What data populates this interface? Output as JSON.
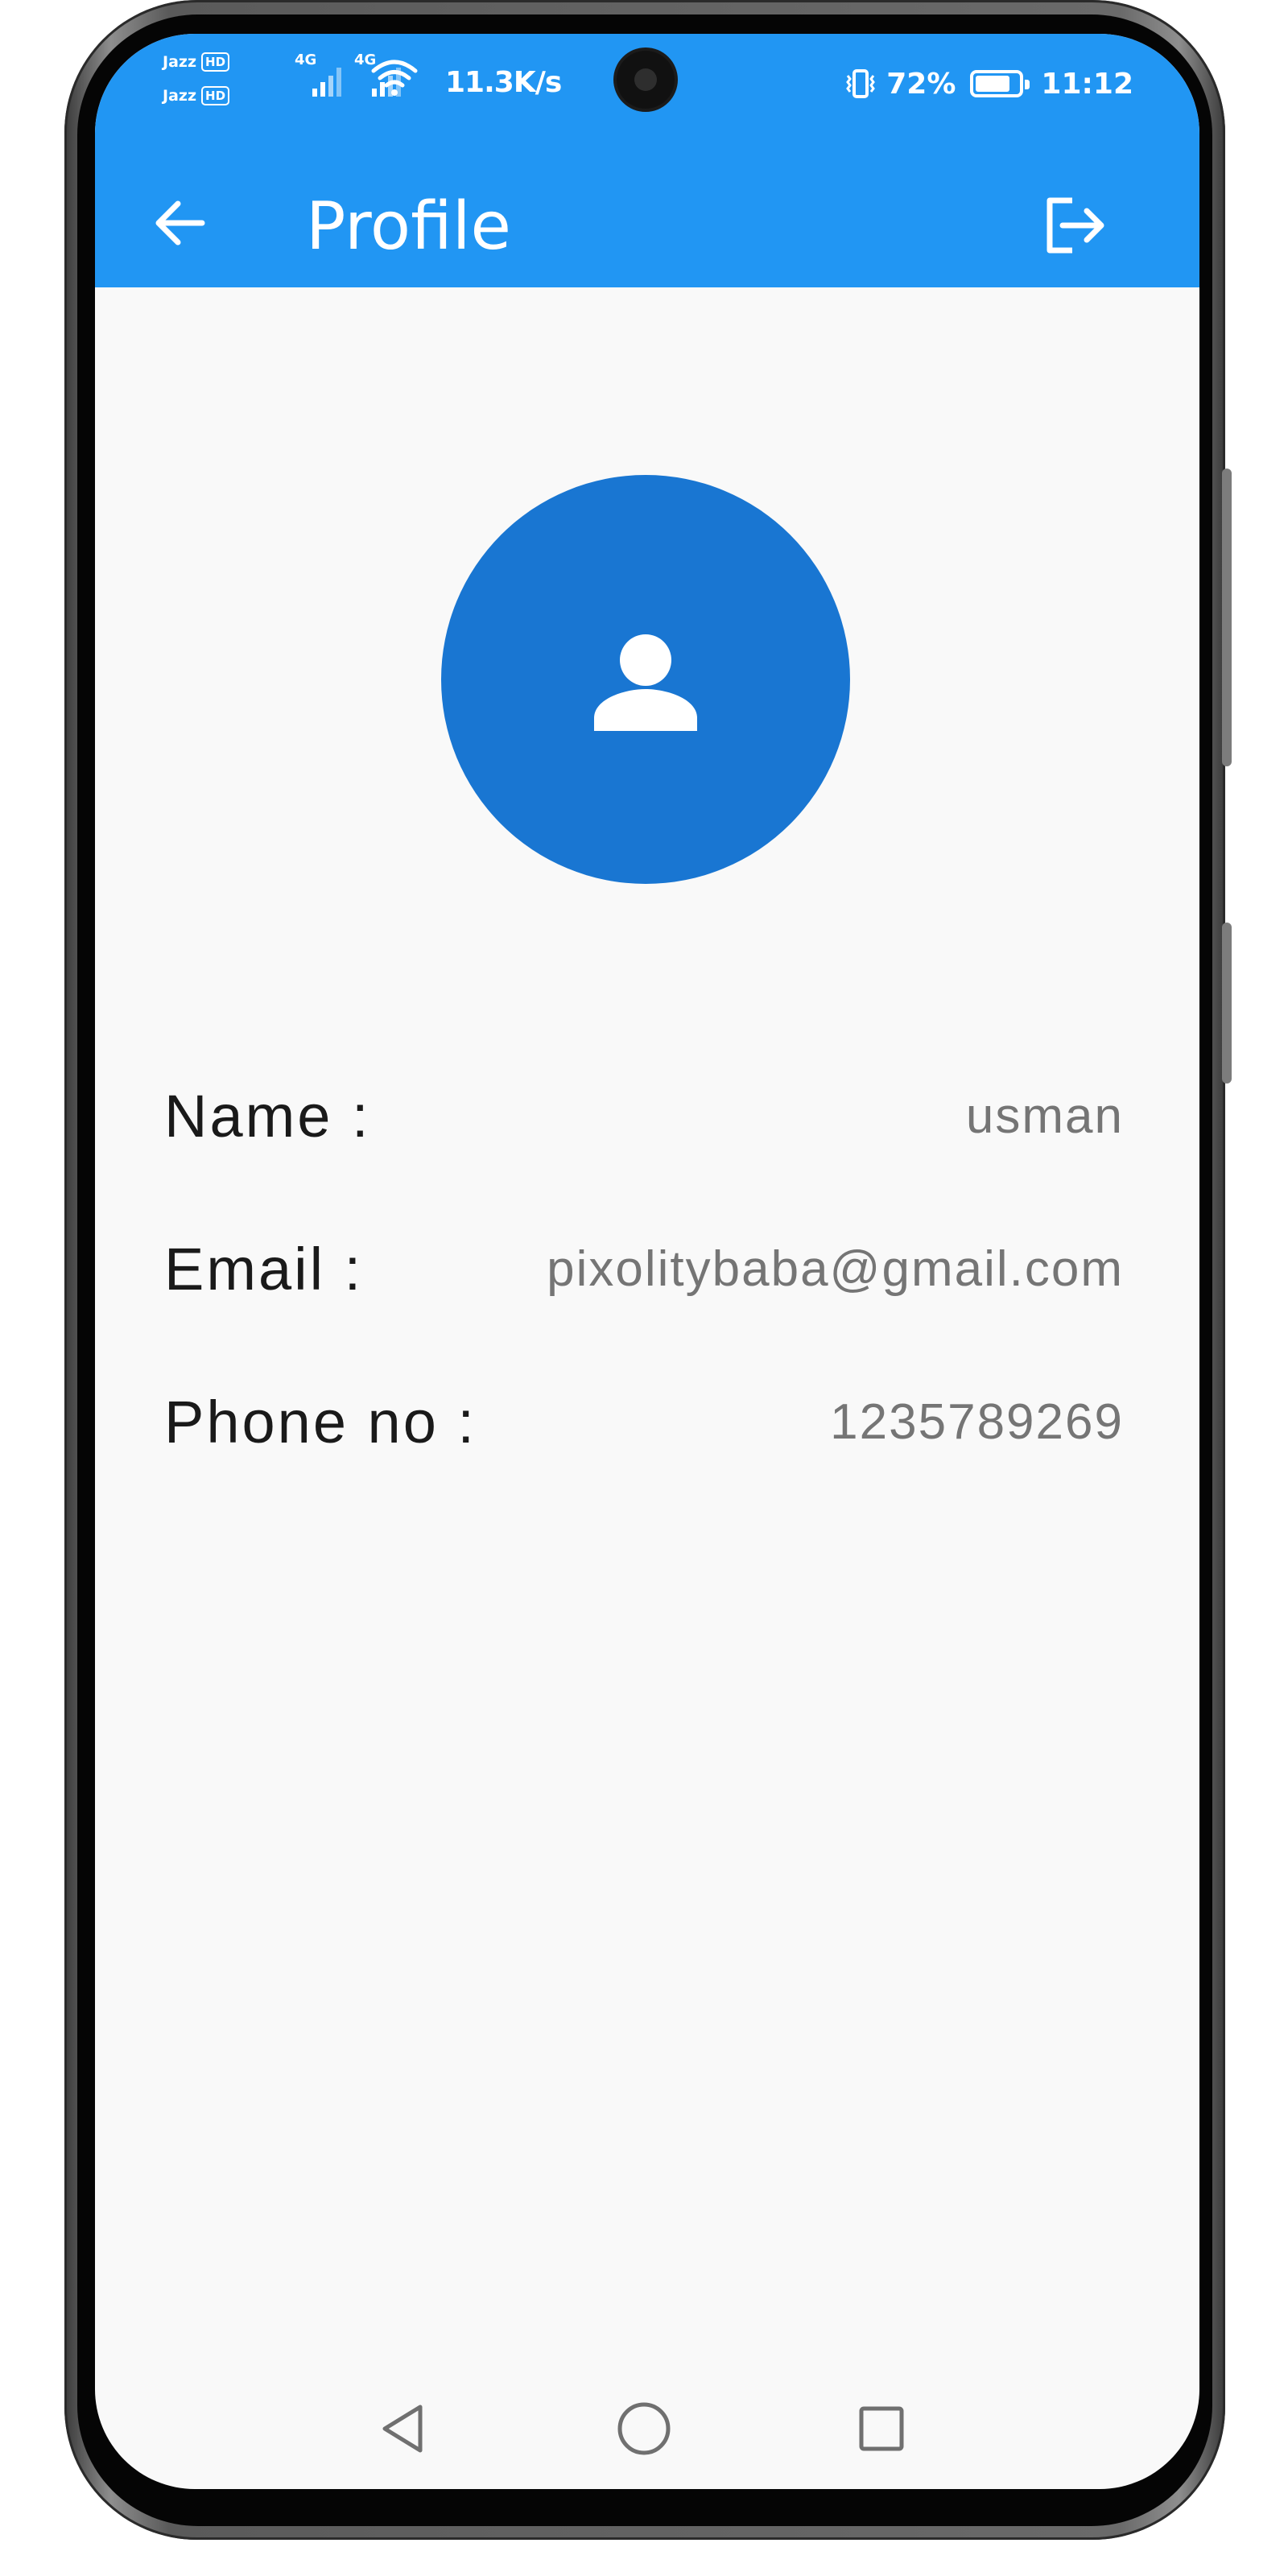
{
  "status_bar": {
    "sim1_carrier": "Jazz",
    "sim2_carrier": "Jazz",
    "hd_badge": "HD",
    "sim1_network": "4G",
    "sim2_network": "4G",
    "net_speed": "11.3K/s",
    "battery_percent": "72%",
    "battery_level": 0.72,
    "time": "11:12",
    "icons": [
      "signal-icon",
      "wifi-icon",
      "vibrate-icon",
      "battery-icon",
      "camera-cutout"
    ]
  },
  "header": {
    "title": "Profile",
    "back_icon": "arrow-left-icon",
    "logout_icon": "logout-icon",
    "background_color": "#2196f3"
  },
  "avatar": {
    "icon": "person-icon",
    "background_color": "#1976d2"
  },
  "profile": {
    "fields": [
      {
        "label": "Name :",
        "value": "usman"
      },
      {
        "label": "Email :",
        "value": "pixolitybaba@gmail.com"
      },
      {
        "label": "Phone no :",
        "value": "1235789269"
      }
    ]
  },
  "nav_bar": {
    "icons": [
      "nav-back-icon",
      "nav-home-icon",
      "nav-recents-icon"
    ]
  },
  "colors": {
    "page_background": "#f9f9f9",
    "label_text": "#1a1a1a",
    "value_text": "#757575"
  }
}
